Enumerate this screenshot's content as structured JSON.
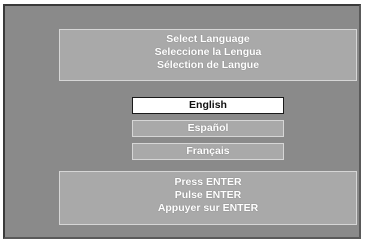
{
  "header": {
    "lines": [
      "Select Language",
      "Seleccione la Lengua",
      "Sélection de Langue"
    ]
  },
  "options": [
    {
      "label": "English",
      "selected": true
    },
    {
      "label": "Español",
      "selected": false
    },
    {
      "label": "Français",
      "selected": false
    }
  ],
  "footer": {
    "lines": [
      "Press ENTER",
      "Pulse ENTER",
      "Appuyer sur ENTER"
    ]
  }
}
